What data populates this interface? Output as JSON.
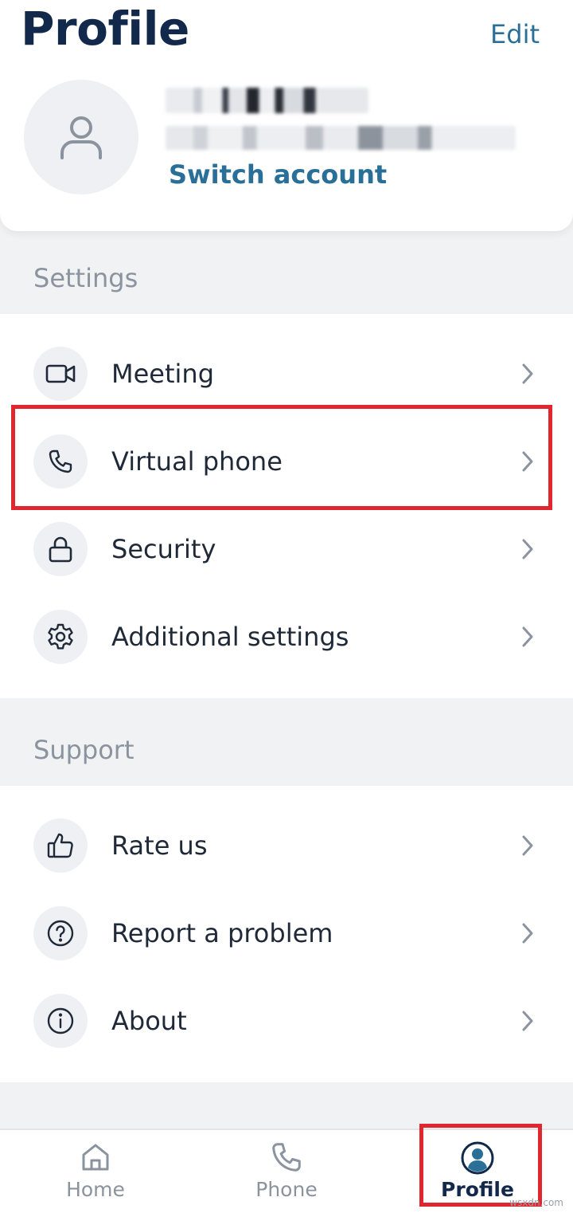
{
  "header": {
    "title": "Profile",
    "edit_label": "Edit",
    "switch_account_label": "Switch account"
  },
  "settings": {
    "section_label": "Settings",
    "items": [
      {
        "label": "Meeting",
        "icon": "video-camera-icon"
      },
      {
        "label": "Virtual phone",
        "icon": "phone-icon"
      },
      {
        "label": "Security",
        "icon": "lock-icon"
      },
      {
        "label": "Additional settings",
        "icon": "gear-icon"
      }
    ]
  },
  "support": {
    "section_label": "Support",
    "items": [
      {
        "label": "Rate us",
        "icon": "thumbs-up-icon"
      },
      {
        "label": "Report a problem",
        "icon": "question-circle-icon"
      },
      {
        "label": "About",
        "icon": "info-circle-icon"
      }
    ]
  },
  "tabbar": {
    "tabs": [
      {
        "label": "Home",
        "icon": "home-icon",
        "active": false
      },
      {
        "label": "Phone",
        "icon": "phone-icon",
        "active": false
      },
      {
        "label": "Profile",
        "icon": "profile-icon",
        "active": true
      }
    ]
  },
  "watermark": "wsxdn.com",
  "colors": {
    "accent": "#2a6f97",
    "title": "#13294b",
    "highlight": "#e0262f",
    "background": "#f1f2f4"
  }
}
